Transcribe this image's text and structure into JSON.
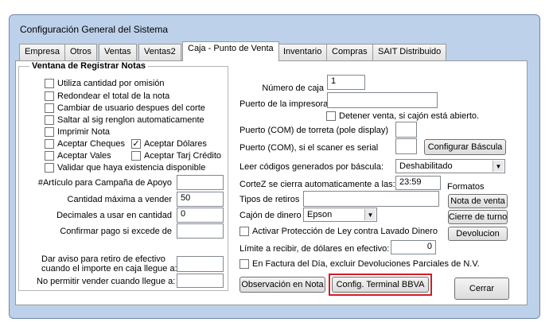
{
  "window": {
    "title": "Configuración General del Sistema"
  },
  "tabs": [
    "Empresa",
    "Otros",
    "Ventas",
    "Ventas2",
    "Caja - Punto de Venta",
    "Inventario",
    "Compras",
    "SAIT Distribuido"
  ],
  "active_tab": "Caja - Punto de Venta",
  "group": {
    "title": "Ventana de Registrar Notas",
    "checkboxes": [
      {
        "label": "Utiliza cantidad por omisión",
        "checked": false
      },
      {
        "label": "Redondear el total de la nota",
        "checked": false
      },
      {
        "label": "Cambiar de usuario despues del corte",
        "checked": false
      },
      {
        "label": "Saltar al sig  renglon automaticamente",
        "checked": false
      },
      {
        "label": "Imprimir Nota",
        "checked": false
      },
      {
        "label": "Aceptar Cheques",
        "checked": false
      },
      {
        "label": "Aceptar Dólares",
        "checked": true
      },
      {
        "label": "Aceptar Vales",
        "checked": false
      },
      {
        "label": "Aceptar Tarj Crédito",
        "checked": false
      },
      {
        "label": "Validar que haya existencia disponible",
        "checked": false
      }
    ],
    "fields": {
      "articulo_label": "#Artículo para Campaña de Apoyo",
      "articulo_value": "",
      "cantidad_max_label": "Cantidad máxima a vender",
      "cantidad_max_value": "50",
      "decimales_label": "Decimales a usar en cantidad",
      "decimales_value": "0",
      "confirmar_label": "Confirmar pago si excede de",
      "confirmar_value": ""
    }
  },
  "aviso": {
    "line1": "Dar aviso para retiro de efectivo",
    "line2": "cuando el importe en caja llegue a:",
    "aviso_value": "",
    "no_permitir_label": "No permitir vender cuando llegue a:",
    "no_permitir_value": ""
  },
  "right": {
    "numero_caja_label": "Número de caja",
    "numero_caja_value": "1",
    "puerto_impresora_label": "Puerto de la impresora",
    "puerto_impresora_value": "",
    "detener_label": "Detener venta, si cajón está abierto.",
    "torreta_label": "Puerto (COM) de torreta (pole display)",
    "torreta_value": "",
    "scanner_label": "Puerto (COM), si el scaner es serial",
    "scanner_value": "",
    "configurar_bascula": "Configurar Báscula",
    "leer_codigos_label": "Leer códigos generados por báscula:",
    "leer_codigos_value": "Deshabilitado",
    "cortez_label": "CorteZ se cierra automaticamente a las:",
    "cortez_value": "23:59",
    "tipos_retiros_label": "Tipos de retiros",
    "tipos_retiros_value": "",
    "cajon_label": "Cajón de dinero",
    "cajon_value": "Epson",
    "lavado_label": "Activar Protección de Ley contra Lavado Dinero",
    "limite_label": "Límite a recibir, de dólares en efectivo:",
    "limite_value": "0",
    "factura_dia_label": "En Factura del Día, excluir Devoluciones Parciales de N.V.",
    "formatos_label": "Formatos",
    "nota_venta": "Nota de venta",
    "cierre_turno": "Cierre de turno",
    "devolucion": "Devolucion",
    "observacion": "Observación en Nota",
    "config_bbva": "Config. Terminal BBVA",
    "cerrar": "Cerrar"
  }
}
